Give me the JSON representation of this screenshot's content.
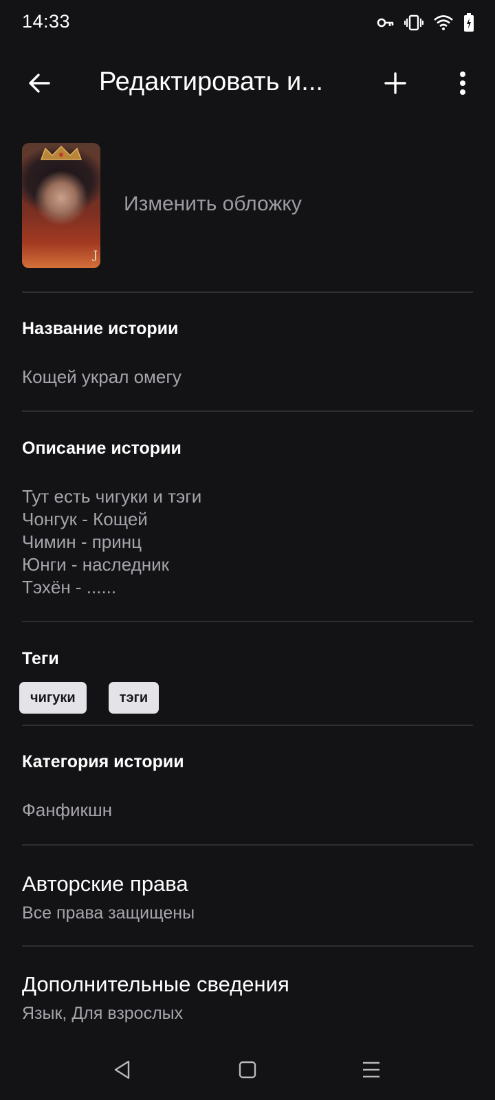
{
  "status_bar": {
    "time": "14:33",
    "icons": [
      "vpn-key-icon",
      "vibrate-icon",
      "wifi-icon",
      "battery-charging-icon"
    ]
  },
  "app_bar": {
    "title": "Редактировать и...",
    "back_icon": "arrow-left-icon",
    "add_icon": "plus-icon",
    "more_icon": "more-vertical-icon"
  },
  "cover": {
    "change_label": "Изменить обложку",
    "cover_letter": "J"
  },
  "story_title": {
    "label": "Название истории",
    "value": "Кощей украл омегу"
  },
  "story_description": {
    "label": "Описание истории",
    "lines": [
      "Тут есть чигуки и тэги",
      "Чонгук - Кощей",
      "Чимин - принц",
      "Юнги - наследник",
      "Тэхён - ......"
    ]
  },
  "tags": {
    "label": "Теги",
    "items": [
      "чигуки",
      "тэги"
    ]
  },
  "category": {
    "label": "Категория истории",
    "value": "Фанфикшн"
  },
  "copyright": {
    "title": "Авторские права",
    "subtitle": "Все права защищены"
  },
  "additional": {
    "title": "Дополнительные сведения",
    "subtitle": "Язык, Для взрослых"
  },
  "colors": {
    "background": "#131215",
    "divider": "#2f2e33",
    "secondary_text": "#a7a5ab",
    "chip_bg": "#e4e3e8"
  }
}
